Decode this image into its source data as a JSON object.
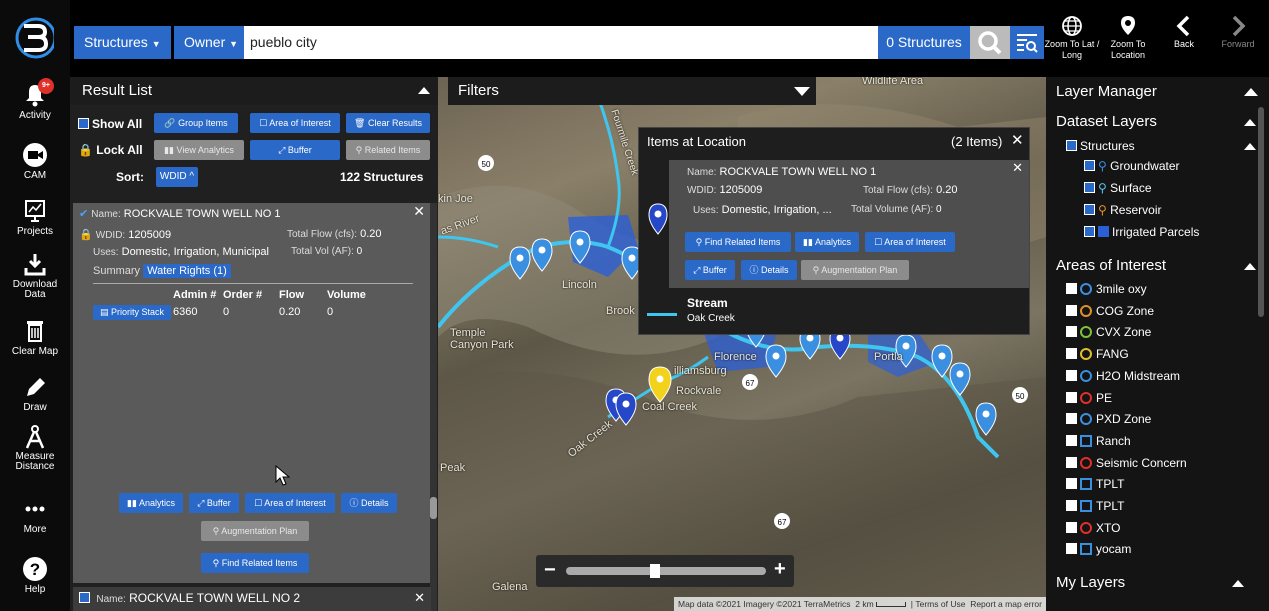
{
  "rail": {
    "items": [
      {
        "label": "Activity",
        "badge": "9+"
      },
      {
        "label": "CAM"
      },
      {
        "label": "Projects"
      },
      {
        "label": "Download Data"
      },
      {
        "label": "Clear Map"
      },
      {
        "label": "Draw"
      },
      {
        "label": "Measure Distance"
      },
      {
        "label": "More"
      },
      {
        "label": "Help"
      }
    ]
  },
  "topbar": {
    "type_dropdown": "Structures",
    "field_dropdown": "Owner",
    "search_value": "pueblo city",
    "count": "0 Structures",
    "zoom_latlong": "Zoom To Lat / Long",
    "zoom_location": "Zoom To Location",
    "back": "Back",
    "forward": "Forward"
  },
  "result": {
    "title": "Result List",
    "show_all": "Show All",
    "group_items": "Group Items",
    "area_of_interest": "Area of Interest",
    "clear_results": "Clear Results",
    "lock_all": "Lock All",
    "view_analytics": "View Analytics",
    "buffer": "Buffer",
    "related_items": "Related Items",
    "sort_label": "Sort:",
    "sort_value": "WDID",
    "total": "122 Structures",
    "card1": {
      "name_label": "Name:",
      "name": "ROCKVALE TOWN WELL NO 1",
      "wdid_label": "WDID:",
      "wdid": "1205009",
      "flow_label": "Total Flow (cfs):",
      "flow": "0.20",
      "uses_label": "Uses:",
      "uses": "Domestic, Irrigation, Municipal",
      "vol_label": "Total Vol (AF):",
      "vol": "0",
      "tab_summary": "Summary",
      "tab_rights": "Water Rights (1)",
      "col_admin": "Admin #",
      "col_order": "Order #",
      "col_flow": "Flow",
      "col_volume": "Volume",
      "priority_stack": "Priority Stack",
      "row_admin": "6360",
      "row_order": "0",
      "row_flow": "0.20",
      "row_volume": "0",
      "btn_analytics": "Analytics",
      "btn_buffer": "Buffer",
      "btn_aoi": "Area of Interest",
      "btn_details": "Details",
      "btn_augmentation": "Augmentation Plan",
      "btn_find_related": "Find Related Items"
    },
    "card2": {
      "name_label": "Name:",
      "name": "ROCKVALE TOWN WELL NO 2"
    }
  },
  "filters": {
    "title": "Filters"
  },
  "popup": {
    "title": "Items at Location",
    "count": "(2 Items)",
    "name_label": "Name:",
    "name": "ROCKVALE TOWN WELL NO 1",
    "wdid_label": "WDID:",
    "wdid": "1205009",
    "flow_label": "Total Flow (cfs):",
    "flow": "0.20",
    "uses_label": "Uses:",
    "uses": "Domestic, Irrigation, ...",
    "vol_label": "Total Volume (AF):",
    "vol": "0",
    "btn_find_related": "Find Related Items",
    "btn_analytics": "Analytics",
    "btn_aoi": "Area of Interest",
    "btn_buffer": "Buffer",
    "btn_details": "Details",
    "btn_augmentation": "Augmentation Plan",
    "stream_title": "Stream",
    "stream_name": "Oak Creek"
  },
  "map": {
    "labels": [
      "Wildlife Area",
      "kin Joe",
      "Lincoln",
      "Brook",
      "Temple Canyon Park",
      "Florence",
      "Portla",
      "illiamsburg",
      "Rockvale",
      "Coal Creek",
      "Oak Creek",
      "Peak",
      "Galena",
      "Fourmile Creek",
      "as River",
      "50",
      "67",
      "50",
      "67"
    ],
    "attribution": "Map data ©2021 Imagery ©2021 TerraMetrics",
    "scale": "2 km",
    "terms": "Terms of Use",
    "report": "Report a map error"
  },
  "layers": {
    "title": "Layer Manager",
    "dataset_title": "Dataset Layers",
    "structures": "Structures",
    "groundwater": "Groundwater",
    "surface": "Surface",
    "reservoir": "Reservoir",
    "irrigated": "Irrigated Parcels",
    "aoi_title": "Areas of Interest",
    "aoi": [
      {
        "label": "3mile oxy",
        "shape": "ring",
        "color": "#3a8fe0"
      },
      {
        "label": "COG Zone",
        "shape": "ring",
        "color": "#e0902a"
      },
      {
        "label": "CVX Zone",
        "shape": "ring",
        "color": "#7dc23a"
      },
      {
        "label": "FANG",
        "shape": "ring",
        "color": "#e0c02a"
      },
      {
        "label": "H2O Midstream",
        "shape": "ring",
        "color": "#3a8fe0"
      },
      {
        "label": "PE",
        "shape": "ring",
        "color": "#e0302a"
      },
      {
        "label": "PXD Zone",
        "shape": "ring",
        "color": "#3a8fe0"
      },
      {
        "label": "Ranch",
        "shape": "sq",
        "color": "#3a8fe0"
      },
      {
        "label": "Seismic Concern",
        "shape": "ring",
        "color": "#e0302a"
      },
      {
        "label": "TPLT",
        "shape": "sq",
        "color": "#3a8fe0"
      },
      {
        "label": "TPLT",
        "shape": "sq",
        "color": "#3a8fe0"
      },
      {
        "label": "XTO",
        "shape": "ring",
        "color": "#e0302a"
      },
      {
        "label": "yocam",
        "shape": "sq",
        "color": "#3a8fe0"
      }
    ],
    "my_layers": "My Layers"
  },
  "colors": {
    "accent": "#2a69c8",
    "stream": "#3ec6f0",
    "marker": "#3b8fe0",
    "selected_marker": "#f2d21b"
  }
}
